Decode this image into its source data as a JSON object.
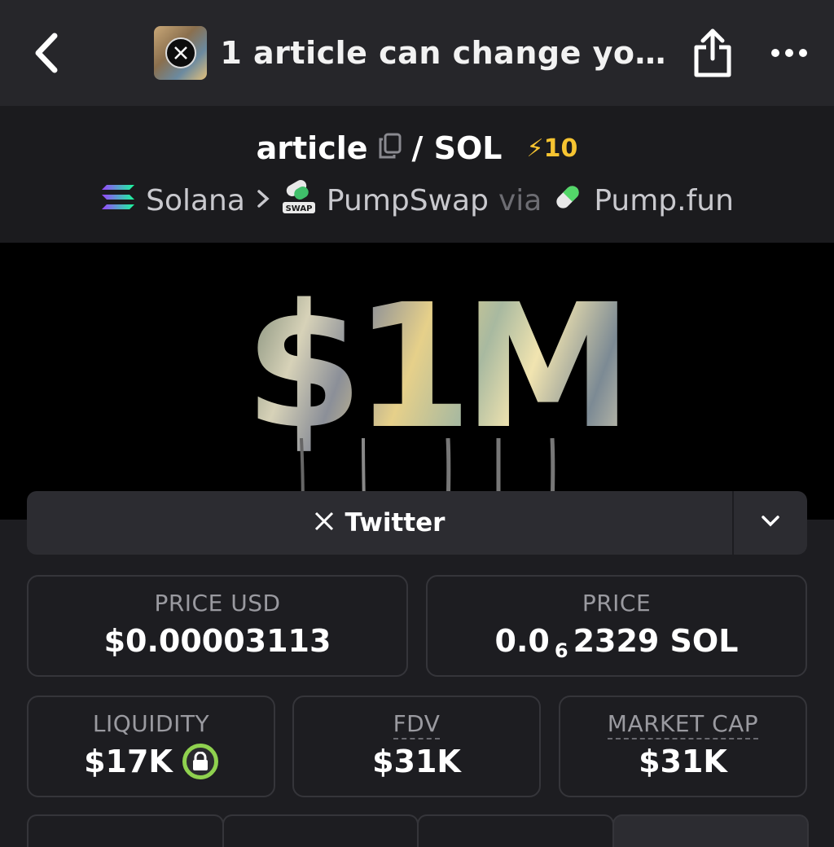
{
  "topbar": {
    "tab_title": "1 article can change yo…",
    "icons": [
      "back-chevron-icon",
      "x-logo-icon",
      "share-icon",
      "more-dots-icon"
    ]
  },
  "pair": {
    "token": "article",
    "quote": "/ SOL",
    "boost": "10"
  },
  "chain": {
    "network": "Solana",
    "dex": "PumpSwap",
    "via": "via",
    "launchpad": "Pump.fun",
    "dex_badge": "SWAP"
  },
  "banner": {
    "text": "$1M"
  },
  "twitter_button": {
    "label": "Twitter"
  },
  "stats": {
    "price_usd": {
      "label": "PRICE USD",
      "value": "$0.00003113"
    },
    "price": {
      "label": "PRICE",
      "prefix": "0.0",
      "zeros": "6",
      "suffix": "2329 SOL"
    },
    "liquidity": {
      "label": "LIQUIDITY",
      "value": "$17K"
    },
    "fdv": {
      "label": "FDV",
      "value": "$31K"
    },
    "market_cap": {
      "label": "MARKET CAP",
      "value": "$31K"
    }
  },
  "colors": {
    "background": "#1d1d21",
    "boost": "#f6c431",
    "lock_ring": "#8fd14f"
  }
}
